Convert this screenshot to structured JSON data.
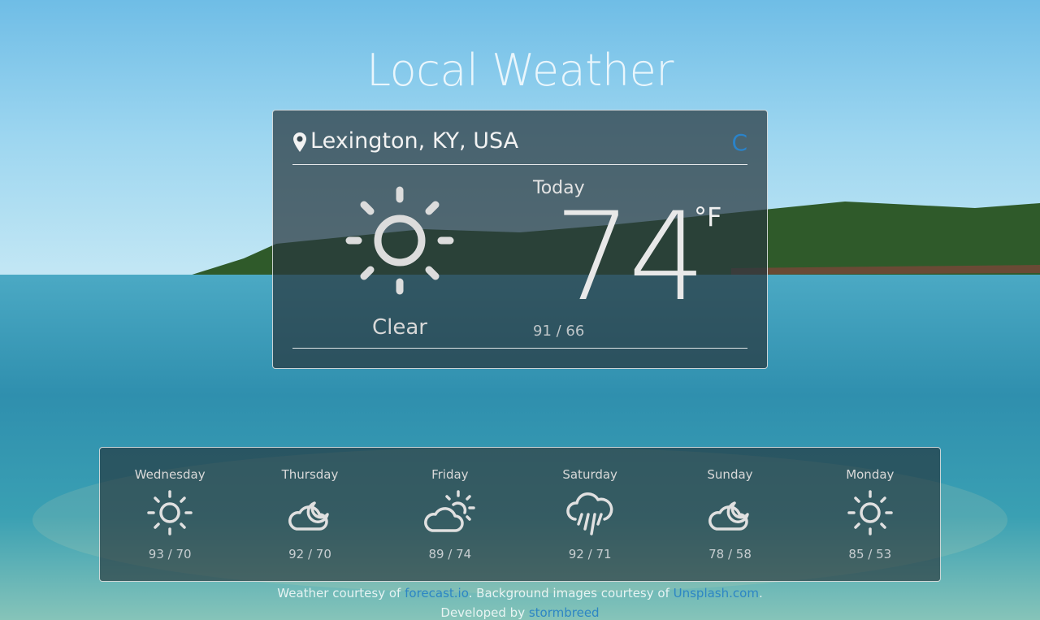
{
  "app": {
    "title": "Local Weather"
  },
  "current": {
    "location": "Lexington, KY, USA",
    "unit_toggle": "C",
    "label": "Today",
    "temperature": "74",
    "unit": "°F",
    "condition": "Clear",
    "hilo": "91 / 66",
    "icon": "sun-icon"
  },
  "forecast": [
    {
      "day": "Wednesday",
      "hilo": "93 / 70",
      "icon": "sun-icon"
    },
    {
      "day": "Thursday",
      "hilo": "92 / 70",
      "icon": "cloud-moon-icon"
    },
    {
      "day": "Friday",
      "hilo": "89 / 74",
      "icon": "partly-sunny-icon"
    },
    {
      "day": "Saturday",
      "hilo": "92 / 71",
      "icon": "rain-icon"
    },
    {
      "day": "Sunday",
      "hilo": "78 / 58",
      "icon": "cloud-moon-icon"
    },
    {
      "day": "Monday",
      "hilo": "85 / 53",
      "icon": "sun-icon"
    }
  ],
  "footer": {
    "prefix": "Weather courtesy of ",
    "weather_link": "forecast.io",
    "middle": ". Background images courtesy of ",
    "images_link": "Unsplash.com",
    "suffix": ".",
    "dev_prefix": "Developed by ",
    "dev_link": "stormbreed"
  },
  "colors": {
    "accent": "#2a83c9",
    "card_bg": "rgba(40,55,62,0.72)"
  }
}
